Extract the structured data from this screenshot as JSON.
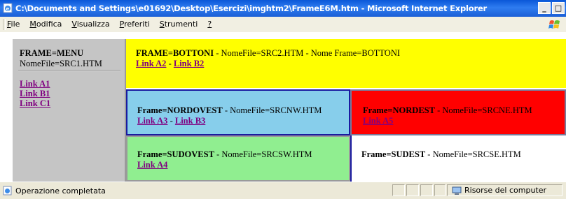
{
  "window": {
    "title": "C:\\Documents and Settings\\e01692\\Desktop\\Esercizi\\imghtm2\\FrameE6M.htm - Microsoft Internet Explorer",
    "buttons": {
      "minimize": "_",
      "restore": "□"
    }
  },
  "menubar": {
    "items": [
      {
        "acc": "F",
        "rest": "ile"
      },
      {
        "acc": "M",
        "rest": "odifica"
      },
      {
        "acc": "V",
        "rest": "isualizza"
      },
      {
        "acc": "P",
        "rest": "referiti"
      },
      {
        "acc": "S",
        "rest": "trumenti"
      },
      {
        "acc": "?",
        "rest": ""
      }
    ]
  },
  "frames": {
    "menu": {
      "title": "FRAME=MENU",
      "file": "NomeFile=SRC1.HTM",
      "links": [
        "Link A1",
        "Link B1",
        "Link C1"
      ]
    },
    "bottoni": {
      "title": "FRAME=BOTTONI",
      "info": " - NomeFile=SRC2.HTM - Nome Frame=BOTTONI",
      "links": [
        "Link A2",
        "Link B2"
      ],
      "sep": " - "
    },
    "nordovest": {
      "title": "Frame=NORDOVEST",
      "info": " - NomeFile=SRCNW.HTM",
      "links": [
        "Link A3",
        "Link B3"
      ],
      "sep": " - "
    },
    "nordest": {
      "title": "Frame=NORDEST",
      "info": " - NomeFile=SRCNE.HTM",
      "links": [
        "Link A5"
      ]
    },
    "sudovest": {
      "title": "Frame=SUDOVEST",
      "info": " - NomeFile=SRCSW.HTM",
      "links": [
        "Link A4"
      ]
    },
    "sudest": {
      "title": "Frame=SUDEST",
      "info": " - NomeFile=SRCSE.HTM"
    }
  },
  "statusbar": {
    "text": "Operazione completata",
    "zone": "Risorse del computer"
  },
  "colors": {
    "bottoni": "#ffff00",
    "nordovest": "#87ceeb",
    "nordest": "#ff0000",
    "sudovest": "#90ee90",
    "sudest": "#ffffff",
    "menu": "#c5c5c5",
    "link": "#800080"
  },
  "icons": [
    "ie-page-icon",
    "windows-logo-icon",
    "status-page-icon",
    "computer-icon"
  ]
}
